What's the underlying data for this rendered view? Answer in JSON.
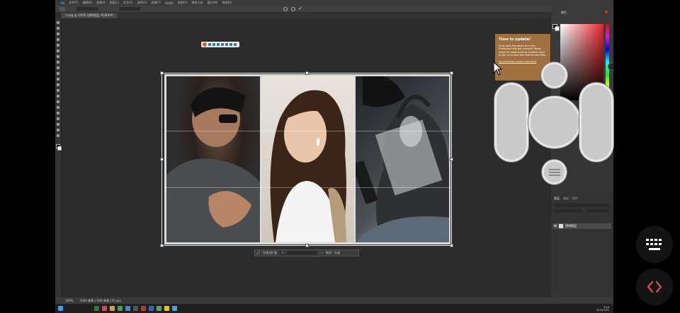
{
  "app": {
    "menu": [
      "文件(F)",
      "编辑(E)",
      "图像(I)",
      "图层(L)",
      "文字(Y)",
      "选择(S)",
      "滤镜(T)",
      "3D(D)",
      "视图(V)",
      "增效工具",
      "窗口(W)",
      "帮助(H)"
    ],
    "document_tab": "1.png @ 100% (透明图层, RGB/8#)",
    "status_zoom": "100%",
    "status_info": "1000 像素 x 600 像素 (72 ppi)"
  },
  "toast": {
    "title": "Time to update!",
    "body": "It has been five weeks since this Photoshop build was released. Please install the latest build via Creative Cloud to stay up to date with features and fixes.",
    "link": "See Photoshop release notes below"
  },
  "context_bar": {
    "label": "生成式扩展",
    "placeholder": "提示",
    "btn1": "取消",
    "btn2": "生成"
  },
  "right_panel": {
    "color_title": "颜色",
    "layers_tabs": [
      "图层",
      "通道",
      "路径"
    ],
    "layer_name": "透明图层"
  },
  "taskbar": {
    "time": "9:44",
    "date": "2024/7/21"
  },
  "colors": {
    "toast_bg": "#a0703e",
    "accent": "#e8252c"
  },
  "icons": {
    "keyboard_fab": "keyboard-icon",
    "code_fab": "code-brackets-icon"
  }
}
